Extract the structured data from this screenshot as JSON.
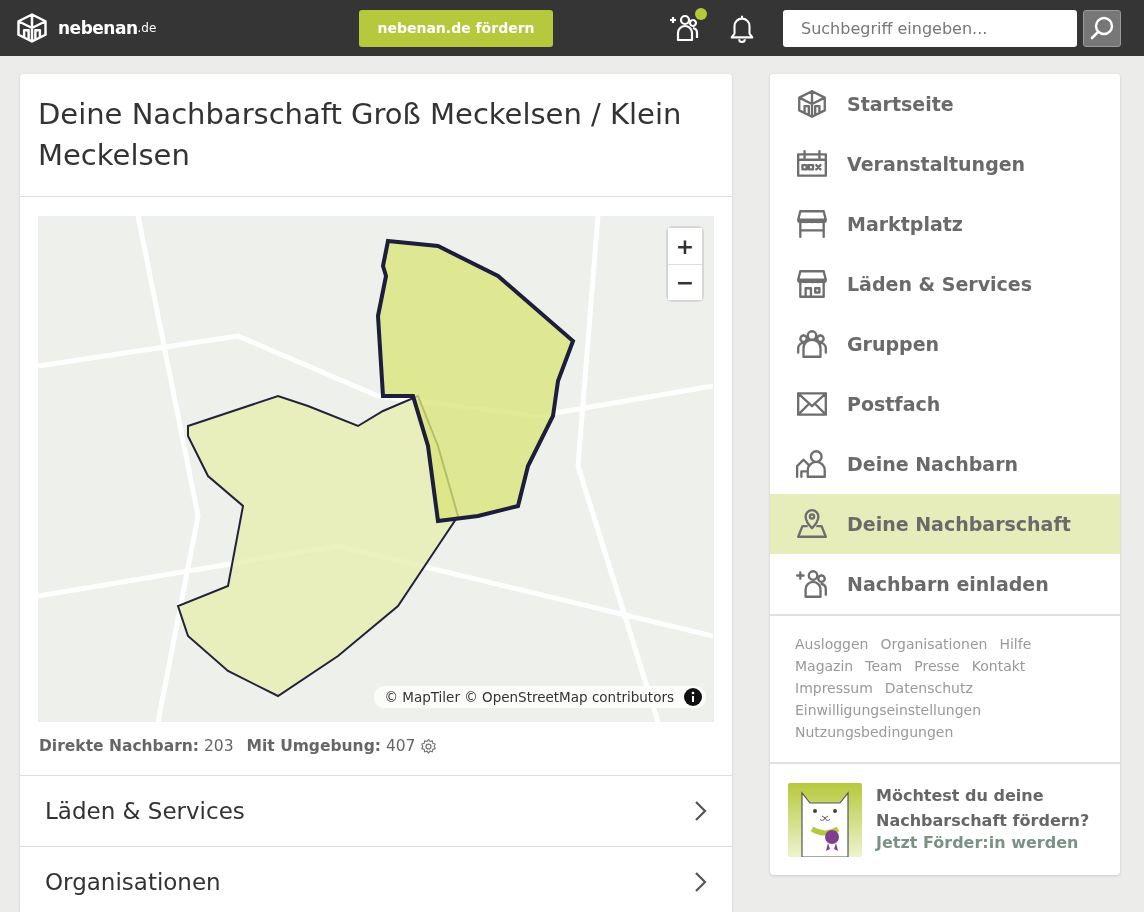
{
  "header": {
    "logo": {
      "name": "nebenan",
      "suffix": ".de"
    },
    "support_button": "nebenan.de fördern",
    "invite_notification": true,
    "search": {
      "placeholder": "Suchbegriff eingeben..."
    }
  },
  "main": {
    "title": "Deine Nachbarschaft Groß Meckelsen / Klein Meckelsen",
    "map": {
      "zoom_in": "+",
      "zoom_out": "−",
      "attribution": "© MapTiler © OpenStreetMap contributors"
    },
    "stats": [
      {
        "label": "Direkte Nachbarn:",
        "value": "203"
      },
      {
        "label": "Mit Umgebung:",
        "value": "407"
      }
    ],
    "sections": [
      {
        "label": "Läden & Services"
      },
      {
        "label": "Organisationen"
      }
    ]
  },
  "sidebar": {
    "items": [
      {
        "label": "Startseite",
        "selected": false
      },
      {
        "label": "Veranstaltungen",
        "selected": false
      },
      {
        "label": "Marktplatz",
        "selected": false
      },
      {
        "label": "Läden & Services",
        "selected": false
      },
      {
        "label": "Gruppen",
        "selected": false
      },
      {
        "label": "Postfach",
        "selected": false
      },
      {
        "label": "Deine Nachbarn",
        "selected": false
      },
      {
        "label": "Deine Nachbarschaft",
        "selected": true
      },
      {
        "label": "Nachbarn einladen",
        "selected": false
      }
    ],
    "footer_links": [
      [
        "Ausloggen",
        "Organisationen",
        "Hilfe"
      ],
      [
        "Magazin",
        "Team",
        "Presse",
        "Kontakt"
      ],
      [
        "Impressum",
        "Datenschutz"
      ],
      [
        "Einwilligungseinstellungen"
      ],
      [
        "Nutzungsbedingungen"
      ]
    ],
    "promo": {
      "question": "Möchtest du deine Nachbarschaft fördern?",
      "link": "Jetzt Förder:in werden"
    }
  }
}
